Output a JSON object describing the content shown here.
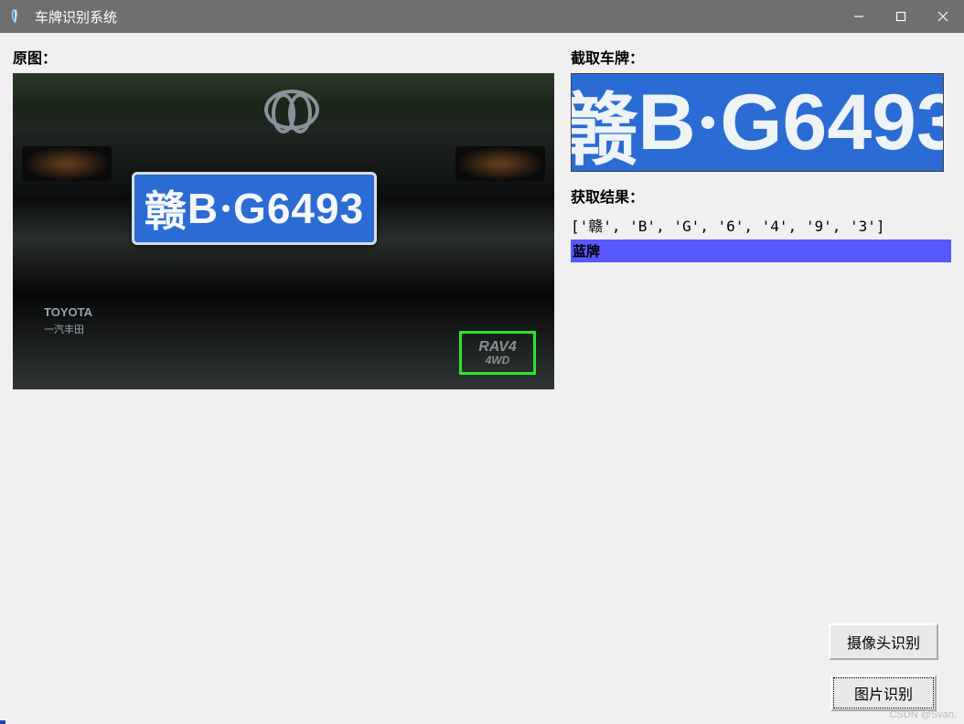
{
  "window": {
    "title": "车牌识别系统"
  },
  "labels": {
    "original_image": "原图：",
    "cropped_plate": "截取车牌：",
    "result": "获取结果："
  },
  "plate": {
    "province": "赣",
    "letter": "B",
    "number": "G6493",
    "full_display": "赣B·G6493"
  },
  "car": {
    "make": "TOYOTA",
    "make_sub": "一汽丰田",
    "model_line1": "RAV4",
    "model_line2": "4WD"
  },
  "result": {
    "array_text": "['赣', 'B', 'G', '6', '4', '9', '3']",
    "plate_type": "蓝牌"
  },
  "buttons": {
    "camera": "摄像头识别",
    "image": "图片识别"
  },
  "watermark": "CSDN @Svan.",
  "colors": {
    "plate_blue": "#2b6bd4",
    "type_bg": "#5858ff",
    "detection_box": "#2ae62a"
  }
}
